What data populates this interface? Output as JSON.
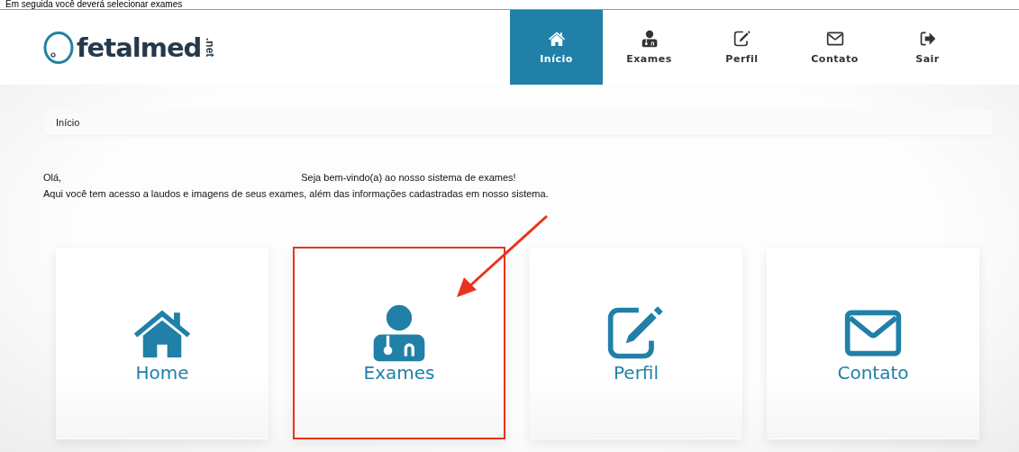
{
  "caption": "Em seguida você deverá selecionar exames",
  "logo": {
    "name": "fetalmed",
    "suffix": ".net"
  },
  "nav": [
    {
      "label": "Início",
      "kind": "home",
      "selected": true
    },
    {
      "label": "Exames",
      "kind": "doctor",
      "selected": false
    },
    {
      "label": "Perfil",
      "kind": "edit",
      "selected": false
    },
    {
      "label": "Contato",
      "kind": "mail",
      "selected": false
    },
    {
      "label": "Sair",
      "kind": "exit",
      "selected": false
    }
  ],
  "breadcrumb": "Início",
  "greeting": {
    "hello": "Olá,",
    "welcome": "Seja bem-vindo(a) ao nosso sistema de exames!",
    "info": "Aqui você tem acesso a laudos e imagens de seus exames, além das informações cadastradas em nosso sistema."
  },
  "cards": [
    {
      "label": "Home",
      "kind": "home",
      "highlighted": false
    },
    {
      "label": "Exames",
      "kind": "doctor",
      "highlighted": true
    },
    {
      "label": "Perfil",
      "kind": "edit",
      "highlighted": false
    },
    {
      "label": "Contato",
      "kind": "mail",
      "highlighted": false
    }
  ]
}
